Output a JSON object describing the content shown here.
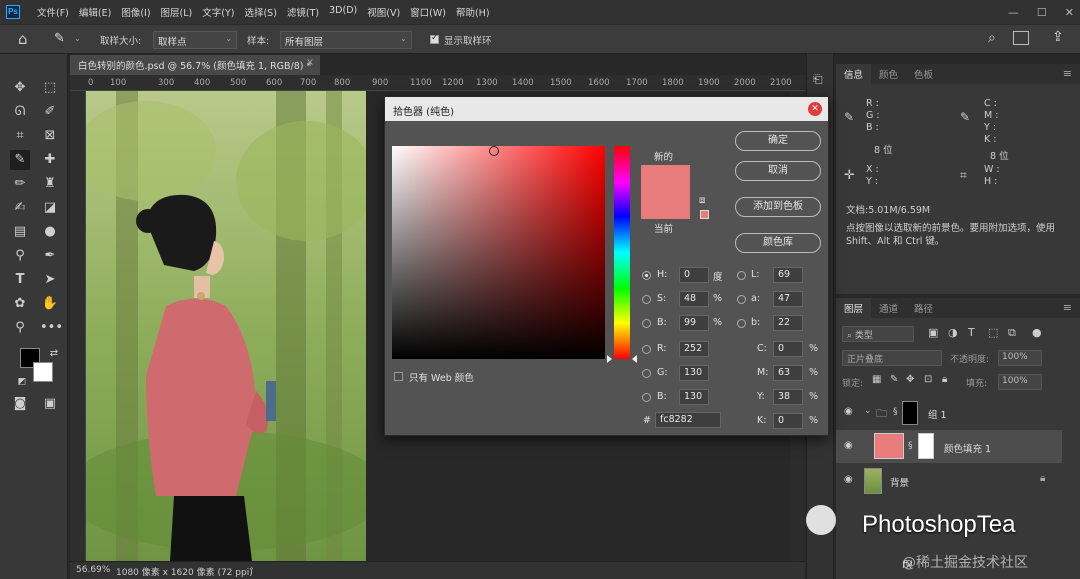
{
  "menubar": {
    "items": [
      "文件(F)",
      "编辑(E)",
      "图像(I)",
      "图层(L)",
      "文字(Y)",
      "选择(S)",
      "滤镜(T)",
      "3D(D)",
      "视图(V)",
      "窗口(W)",
      "帮助(H)"
    ],
    "app_logo": "Ps"
  },
  "options": {
    "sample_size_label": "取样大小:",
    "sample_size_value": "取样点",
    "sample_label": "样本:",
    "sample_value": "所有图层",
    "show_ring_label": "显示取样环"
  },
  "document": {
    "tab_title": "白色转别的颜色.psd @ 56.7% (颜色填充 1, RGB/8) *",
    "ruler_ticks": [
      "0",
      "100",
      "200",
      "300",
      "400",
      "500",
      "600",
      "700",
      "800",
      "900",
      "1000",
      "1100",
      "1200",
      "1300",
      "1400",
      "1500",
      "1600",
      "1700",
      "1800",
      "1900",
      "2000",
      "2100"
    ],
    "zoom": "56.69%",
    "doc_size": "1080 像素 x 1620 像素 (72 ppi)"
  },
  "info_panel": {
    "tabs": [
      "信息",
      "颜色",
      "色板"
    ],
    "rgb_labels": [
      "R :",
      "G :",
      "B :"
    ],
    "rgb_bits": "8 位",
    "cmyk_labels": [
      "C :",
      "M :",
      "Y :",
      "K :"
    ],
    "cmyk_bits": "8 位",
    "xy_labels": [
      "X :",
      "Y :"
    ],
    "wh_labels": [
      "W :",
      "H :"
    ],
    "doc_info": "文档:5.01M/6.59M",
    "hint": "点按图像以选取新的前景色。要用附加选项，使用 Shift、Alt 和 Ctrl 键。"
  },
  "picker": {
    "title": "拾色器 (纯色)",
    "new_label": "新的",
    "current_label": "当前",
    "buttons": [
      "确定",
      "取消",
      "添加到色板",
      "颜色库"
    ],
    "web_only_label": "只有 Web 颜色",
    "hsb": [
      {
        "label": "H:",
        "value": "0",
        "unit": "度"
      },
      {
        "label": "S:",
        "value": "48",
        "unit": "%"
      },
      {
        "label": "B:",
        "value": "99",
        "unit": "%"
      }
    ],
    "rgb": [
      {
        "label": "R:",
        "value": "252"
      },
      {
        "label": "G:",
        "value": "130"
      },
      {
        "label": "B:",
        "value": "130"
      }
    ],
    "lab": [
      {
        "label": "L:",
        "value": "69"
      },
      {
        "label": "a:",
        "value": "47"
      },
      {
        "label": "b:",
        "value": "22"
      }
    ],
    "cmyk": [
      {
        "label": "C:",
        "value": "0",
        "unit": "%"
      },
      {
        "label": "M:",
        "value": "63",
        "unit": "%"
      },
      {
        "label": "Y:",
        "value": "38",
        "unit": "%"
      },
      {
        "label": "K:",
        "value": "0",
        "unit": "%"
      }
    ],
    "hex_label": "#",
    "hex_value": "fc8282",
    "new_color": "#e87b7b",
    "current_color": "#e87b7b"
  },
  "layers_panel": {
    "tabs": [
      "图层",
      "通道",
      "路径"
    ],
    "kind_filter": "类型",
    "blend_mode": "正片叠底",
    "opacity_label": "不透明度:",
    "opacity_value": "100%",
    "lock_label": "锁定:",
    "fill_label": "填充:",
    "fill_value": "100%",
    "layers": [
      {
        "name": "组 1"
      },
      {
        "name": "颜色填充 1"
      },
      {
        "name": "背景"
      }
    ],
    "fill_color": "#e87b7b"
  },
  "watermark": {
    "brand": "PhotoshopTea",
    "site": "@稀土掘金技术社区"
  }
}
